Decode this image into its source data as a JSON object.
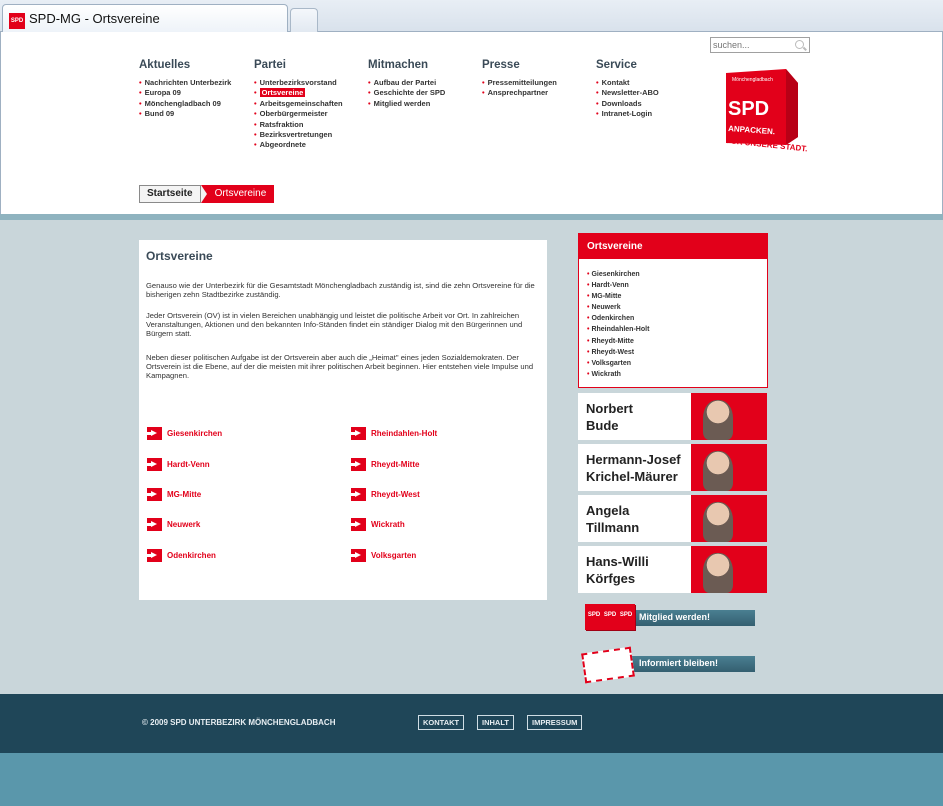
{
  "browser": {
    "tab_title": "SPD-MG - Ortsvereine",
    "favicon": "SPD"
  },
  "search": {
    "placeholder": "suchen..."
  },
  "nav": [
    {
      "title": "Aktuelles",
      "items": [
        "Nachrichten Unterbezirk",
        "Europa 09",
        "Mönchengladbach 09",
        "Bund 09"
      ]
    },
    {
      "title": "Partei",
      "items": [
        "Unterbezirksvorstand",
        "Ortsvereine",
        "Arbeitsgemeinschaften",
        "Oberbürgermeister",
        "Ratsfraktion",
        "Bezirksvertretungen",
        "Abgeordnete"
      ],
      "active_index": 1
    },
    {
      "title": "Mitmachen",
      "items": [
        "Aufbau der Partei",
        "Geschichte der SPD",
        "Mitglied werden"
      ]
    },
    {
      "title": "Presse",
      "items": [
        "Pressemitteilungen",
        "Ansprechpartner"
      ]
    },
    {
      "title": "Service",
      "items": [
        "Kontakt",
        "Newsletter-ABO",
        "Downloads",
        "Intranet-Login"
      ]
    }
  ],
  "logo": {
    "small": "Mönchengladbach",
    "big": "SPD",
    "slogan1": "ANPACKEN.",
    "slogan2": "FÜR UNSERE STADT."
  },
  "breadcrumb": {
    "home": "Startseite",
    "current": "Ortsvereine"
  },
  "content": {
    "title": "Ortsvereine",
    "p1": "Genauso wie der Unterbezirk für die Gesamtstadt Mönchengladbach zuständig ist, sind die zehn Ortsvereine für die bisherigen zehn Stadtbezirke zuständig.",
    "p2": "Jeder Ortsverein (OV) ist in vielen Bereichen unabhängig und leistet die politische Arbeit vor Ort. In zahlreichen Veranstaltungen, Aktionen und den bekannten Info-Ständen findet ein ständiger Dialog mit den Bürgerinnen und Bürgern statt.",
    "p3": "Neben dieser politischen Aufgabe ist der Ortsverein aber auch die „Heimat\" eines jeden Sozialdemokraten. Der Ortsverein ist die Ebene, auf der die meisten mit ihrer politischen Arbeit beginnen. Hier entstehen viele Impulse und Kampagnen.",
    "links_left": [
      "Giesenkirchen",
      "Hardt-Venn",
      "MG-Mitte",
      "Neuwerk",
      "Odenkirchen"
    ],
    "links_right": [
      "Rheindahlen-Holt",
      "Rheydt-Mitte",
      "Rheydt-West",
      "Wickrath",
      "Volksgarten"
    ]
  },
  "sidebar": {
    "title": "Ortsvereine",
    "items": [
      "Giesenkirchen",
      "Hardt-Venn",
      "MG-Mitte",
      "Neuwerk",
      "Odenkirchen",
      "Rheindahlen-Holt",
      "Rheydt-Mitte",
      "Rheydt-West",
      "Volksgarten",
      "Wickrath"
    ]
  },
  "people": [
    {
      "line1": "Norbert",
      "line2": "Bude"
    },
    {
      "line1": "Hermann-Josef",
      "line2": "Krichel-Mäurer"
    },
    {
      "line1": "Angela",
      "line2": "Tillmann"
    },
    {
      "line1": "Hans-Willi",
      "line2": "Körfges"
    }
  ],
  "banners": {
    "member": "Mitglied werden!",
    "member_cube": "SPD",
    "info": "Informiert bleiben!"
  },
  "footer": {
    "copyright": "© 2009 SPD UNTERBEZIRK MÖNCHENGLADBACH",
    "links": [
      "KONTAKT",
      "INHALT",
      "IMPRESSUM"
    ]
  },
  "colors": {
    "brand_red": "#e2001a",
    "footer_dark": "#1f4658",
    "page_bg": "#c9d6da",
    "band": "#5a97ab"
  }
}
